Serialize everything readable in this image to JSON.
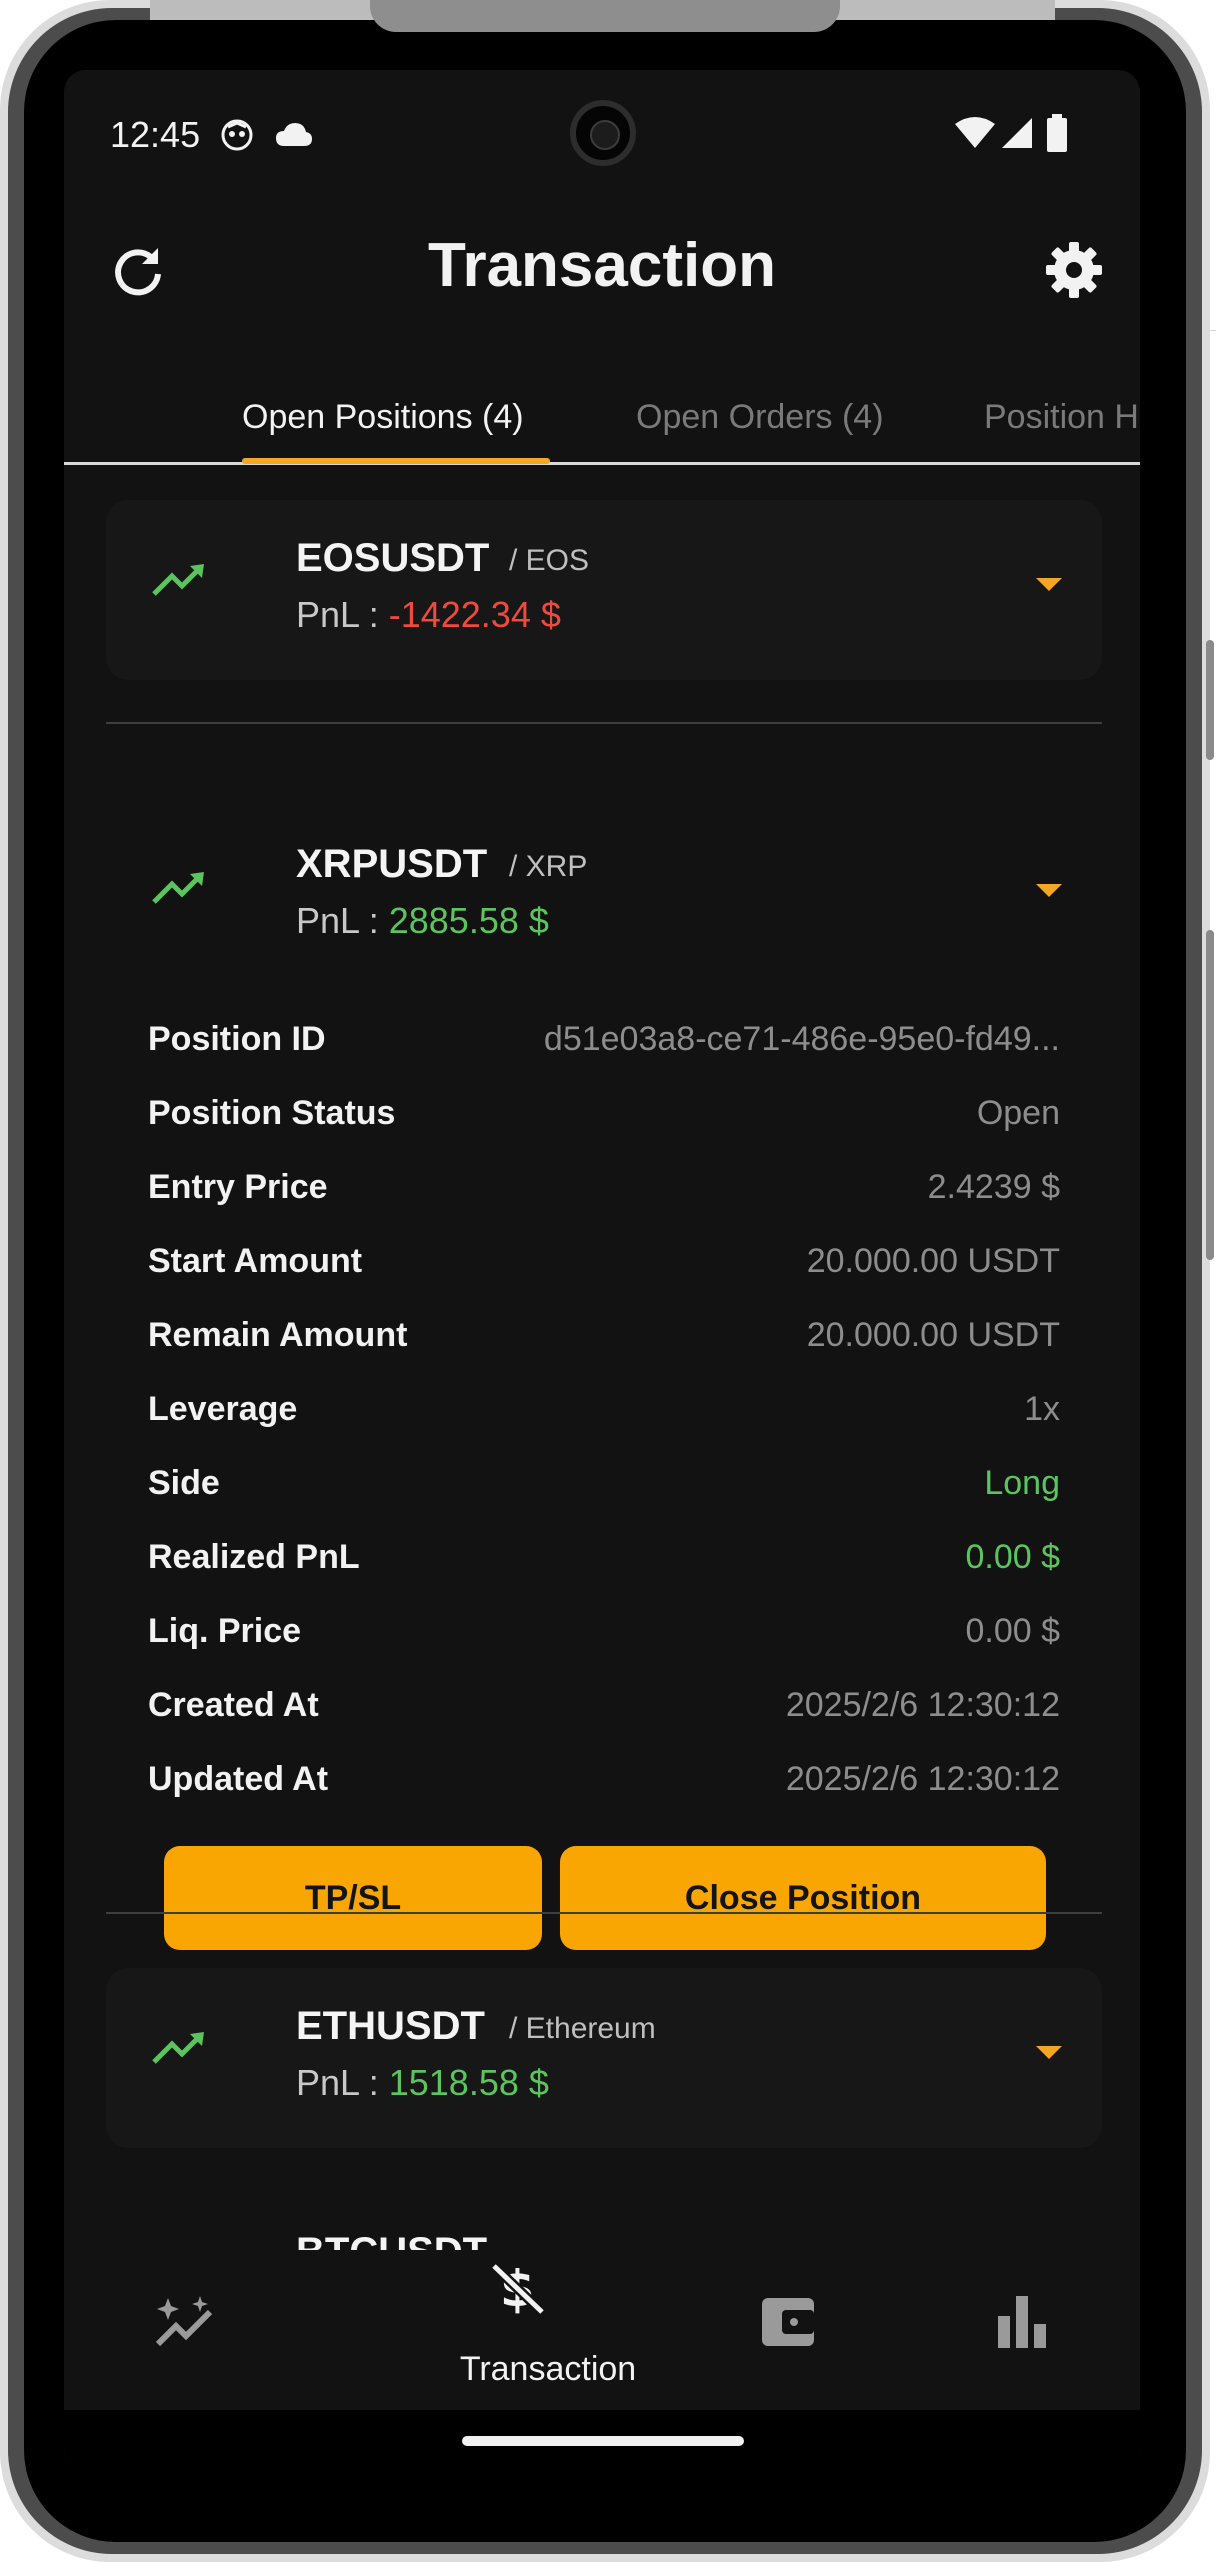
{
  "status_bar": {
    "time": "12:45"
  },
  "app_bar": {
    "title": "Transaction"
  },
  "tabs": [
    {
      "label": "Open Positions (4)",
      "active": true
    },
    {
      "label": "Open Orders (4)",
      "active": false
    },
    {
      "label": "Position H",
      "active": false
    }
  ],
  "positions": [
    {
      "symbol": "EOSUSDT",
      "pair": "/ EOS",
      "pnl_prefix": "PnL : ",
      "pnl": "-1422.34 $",
      "pnl_color": "#f04a3e",
      "expanded": false
    },
    {
      "symbol": "XRPUSDT",
      "pair": "/ XRP",
      "pnl_prefix": "PnL : ",
      "pnl": "2885.58 $",
      "pnl_color": "#5cc45e",
      "expanded": true,
      "details": [
        {
          "label": "Position ID",
          "value": "d51e03a8-ce71-486e-95e0-fd49..."
        },
        {
          "label": "Position Status",
          "value": "Open"
        },
        {
          "label": "Entry Price",
          "value": "2.4239 $"
        },
        {
          "label": "Start Amount",
          "value": "20.000.00 USDT"
        },
        {
          "label": "Remain Amount",
          "value": "20.000.00 USDT"
        },
        {
          "label": "Leverage",
          "value": "1x"
        },
        {
          "label": "Side",
          "value": "Long"
        },
        {
          "label": "Realized PnL",
          "value": "0.00 $"
        },
        {
          "label": "Liq. Price",
          "value": "0.00 $"
        },
        {
          "label": "Created At",
          "value": "2025/2/6 12:30:12"
        },
        {
          "label": "Updated At",
          "value": "2025/2/6 12:30:12"
        }
      ],
      "actions": {
        "tpsl_label": "TP/SL",
        "close_label": "Close Position"
      }
    },
    {
      "symbol": "ETHUSDT",
      "pair": "/ Ethereum",
      "pnl_prefix": "PnL : ",
      "pnl": "1518.58 $",
      "pnl_color": "#5cc45e",
      "expanded": false
    },
    {
      "symbol": "BTCUSDT",
      "pair": "",
      "partially_visible": true
    }
  ],
  "bottom_nav": [
    {
      "icon": "sparkle-chart-icon",
      "label": "",
      "active": false
    },
    {
      "icon": "money-off-icon",
      "label": "Transaction",
      "active": true
    },
    {
      "icon": "wallet-icon",
      "label": "",
      "active": false
    },
    {
      "icon": "bar-chart-icon",
      "label": "",
      "active": false
    }
  ],
  "colors": {
    "accent": "#f9a602",
    "negative": "#f04a3e",
    "positive": "#5cc45e",
    "background": "#121212"
  }
}
